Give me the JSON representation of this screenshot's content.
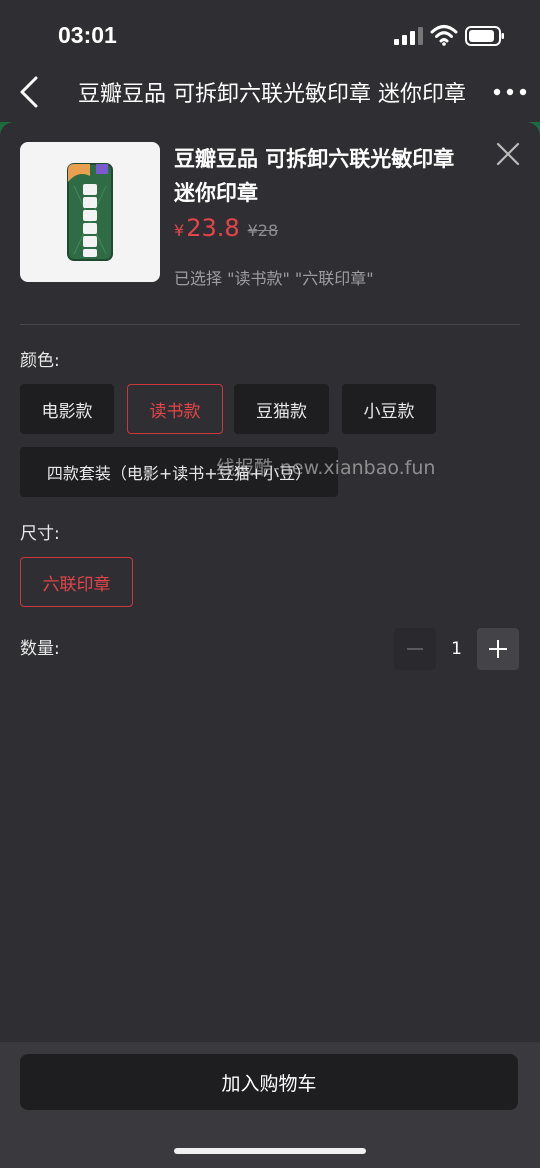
{
  "status_bar": {
    "time": "03:01"
  },
  "nav": {
    "title": "豆瓣豆品 可拆卸六联光敏印章 迷你印章",
    "icons": {
      "back": "chevron-left-icon",
      "more": "more-dots-icon"
    }
  },
  "product": {
    "title": "豆瓣豆品 可拆卸六联光敏印章迷你印章",
    "currency": "¥",
    "price": "23.8",
    "original_price": "¥28",
    "selected_text": "已选择 \"读书款\" \"六联印章\"",
    "image_icon": "stamp-product-image"
  },
  "color_section": {
    "label": "颜色:",
    "options": [
      "电影款",
      "读书款",
      "豆猫款",
      "小豆款",
      "四款套装（电影+读书+豆猫+小豆）"
    ],
    "selected": "读书款"
  },
  "size_section": {
    "label": "尺寸:",
    "options": [
      "六联印章"
    ],
    "selected": "六联印章"
  },
  "quantity": {
    "label": "数量:",
    "value": "1"
  },
  "watermark": "线报酷-new.xianbao.fun",
  "footer": {
    "add_to_cart": "加入购物车"
  },
  "colors": {
    "accent": "#e3454a",
    "sheet": "#2f2f33",
    "button": "#1e1e21"
  }
}
